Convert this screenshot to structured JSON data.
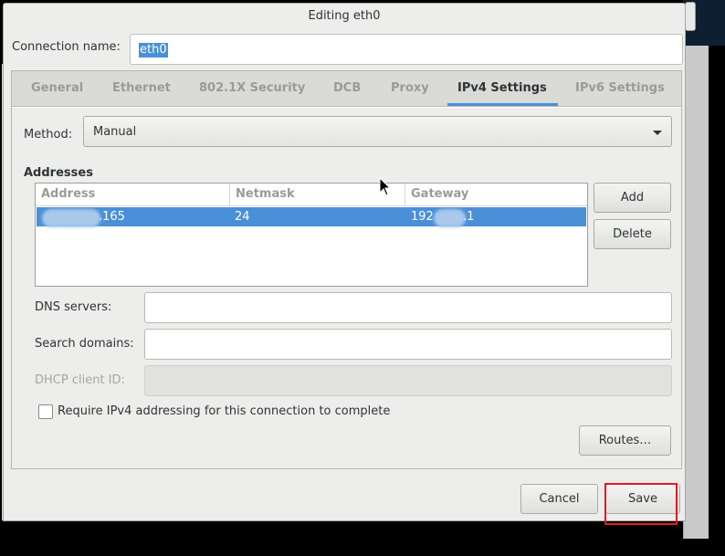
{
  "window": {
    "title": "Editing eth0"
  },
  "connection": {
    "label": "Connection name:",
    "value": "eth0"
  },
  "tabs": [
    {
      "label": "General"
    },
    {
      "label": "Ethernet"
    },
    {
      "label": "802.1X Security"
    },
    {
      "label": "DCB"
    },
    {
      "label": "Proxy"
    },
    {
      "label": "IPv4 Settings",
      "active": true
    },
    {
      "label": "IPv6 Settings"
    }
  ],
  "ipv4": {
    "method_label": "Method:",
    "method_value": "Manual",
    "addresses_heading": "Addresses",
    "columns": [
      "Address",
      "Netmask",
      "Gateway"
    ],
    "rows": [
      {
        "address": ".165",
        "netmask": "24",
        "gateway_prefix": "192",
        "gateway_suffix": ".1"
      }
    ],
    "add_label": "Add",
    "delete_label": "Delete",
    "dns_label": "DNS servers:",
    "dns_value": "",
    "search_label": "Search domains:",
    "search_value": "",
    "dhcp_label": "DHCP client ID:",
    "dhcp_value": "",
    "require_label": "Require IPv4 addressing for this connection to complete",
    "require_checked": false,
    "routes_label": "Routes…"
  },
  "footer": {
    "cancel_label": "Cancel",
    "save_label": "Save"
  },
  "colors": {
    "accent": "#4a90d9",
    "highlight": "#e11a22"
  }
}
